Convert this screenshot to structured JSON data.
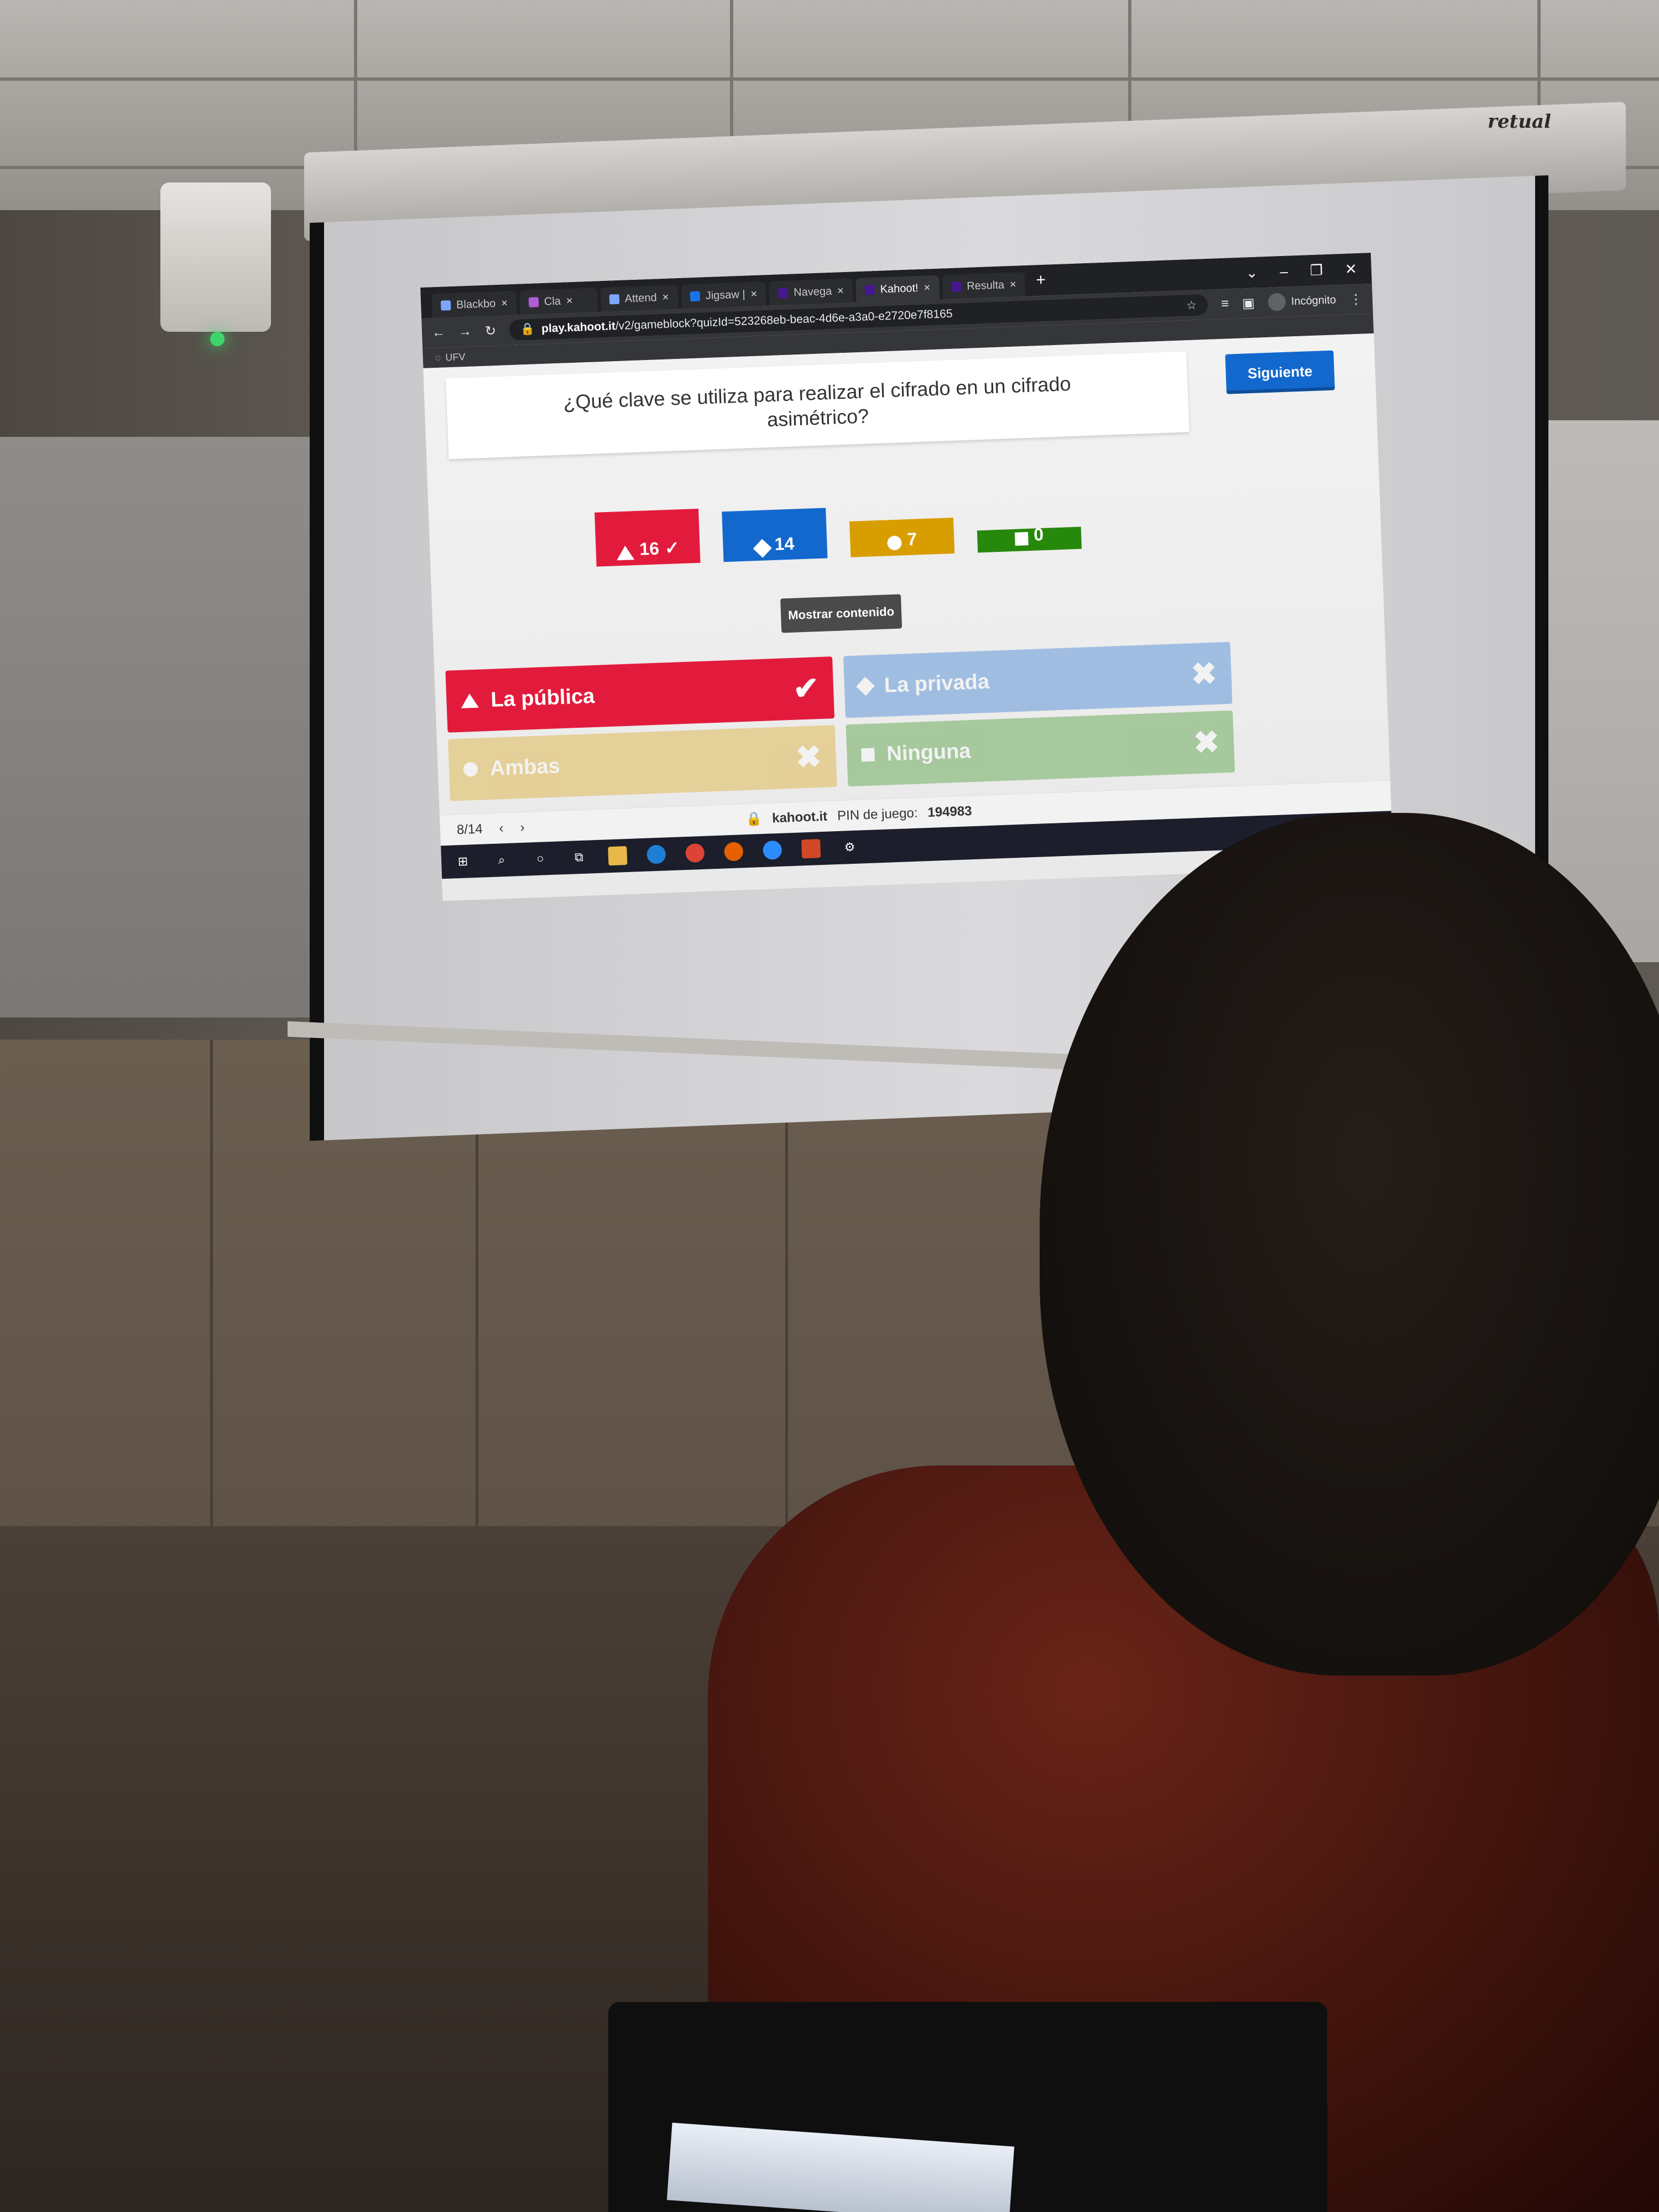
{
  "room": {
    "screen_brand": "retual"
  },
  "browser": {
    "tabs": [
      {
        "label": "Blackbo",
        "active": false
      },
      {
        "label": "Cla",
        "active": false
      },
      {
        "label": "Attend",
        "active": false
      },
      {
        "label": "Jigsaw |",
        "active": false
      },
      {
        "label": "Navega",
        "active": false
      },
      {
        "label": "Kahoot!",
        "active": true
      },
      {
        "label": "Resulta",
        "active": false
      }
    ],
    "tab_close": "×",
    "new_tab": "+",
    "window_controls": [
      "⌄",
      "–",
      "❐",
      "✕"
    ],
    "url_host": "play.kahoot.it",
    "url_path": "/v2/gameblock?quizId=523268eb-beac-4d6e-a3a0-e2720e7f8165",
    "incognito_label": "Incógnito",
    "bookmark": "UFV"
  },
  "kahoot": {
    "question": "¿Qué clave se utiliza para realizar el cifrado en un cifrado asimétrico?",
    "next_button": "Siguiente",
    "show_content": "Mostrar contenido",
    "results": [
      {
        "shape": "triangle",
        "count": "16",
        "correct_mark": "✓",
        "color": "#e21b3c",
        "value": 16
      },
      {
        "shape": "diamond",
        "count": "14",
        "correct_mark": "",
        "color": "#1368ce",
        "value": 14
      },
      {
        "shape": "circle",
        "count": "7",
        "correct_mark": "",
        "color": "#d89e00",
        "value": 7
      },
      {
        "shape": "square",
        "count": "0",
        "correct_mark": "",
        "color": "#26890c",
        "value": 0
      }
    ],
    "answers": [
      {
        "label": "La pública",
        "correct": true,
        "mark": "✔"
      },
      {
        "label": "La privada",
        "correct": false,
        "mark": "✖"
      },
      {
        "label": "Ambas",
        "correct": false,
        "mark": "✖"
      },
      {
        "label": "Ninguna",
        "correct": false,
        "mark": "✖"
      }
    ],
    "footer": {
      "progress": "8/14",
      "site": "kahoot.it",
      "pin_label": "PIN de juego:",
      "pin": "194983"
    }
  },
  "taskbar": {
    "start_icon": "⊞",
    "search_icon": "⌕",
    "cortana_icon": "○",
    "taskview_icon": "⧉",
    "settings_icon": "⚙"
  }
}
